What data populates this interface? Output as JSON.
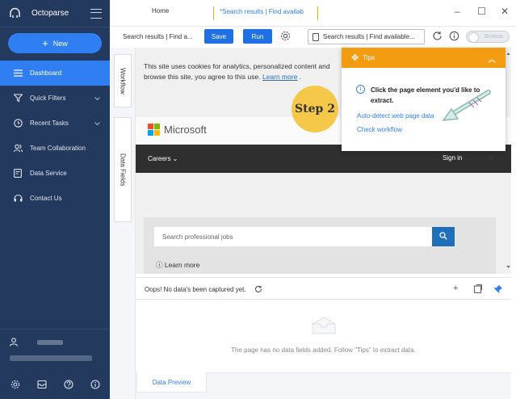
{
  "app": {
    "name": "Octoparse"
  },
  "sidebar": {
    "new_label": "New",
    "items": [
      {
        "label": "Dashboard",
        "icon": "dashboard-icon",
        "active": true
      },
      {
        "label": "Quick Filters",
        "icon": "filter-icon",
        "expandable": true
      },
      {
        "label": "Recent Tasks",
        "icon": "clock-icon",
        "expandable": true
      },
      {
        "label": "Team Collaboration",
        "icon": "team-icon"
      },
      {
        "label": "Data Service",
        "icon": "data-service-icon"
      },
      {
        "label": "Contact Us",
        "icon": "headset-icon"
      }
    ],
    "bottom_icons": [
      "settings-icon",
      "inbox-icon",
      "help-icon",
      "info-icon"
    ]
  },
  "tabs": {
    "home": "Home",
    "active": "*Search results | Find availab"
  },
  "toolbar": {
    "task_name": "Search results | Find a...",
    "save_label": "Save",
    "run_label": "Run",
    "url_text": "Search results | Find available...",
    "browse_label": "Browse"
  },
  "side_tabs": {
    "workflow": "Workflow",
    "data_fields": "Data Fields"
  },
  "page": {
    "cookie_text": "This site uses cookies for analytics, personalized content and",
    "cookie_text2": "browse this site, you agree to this use.",
    "learn_more": "Learn more",
    "logo_text": "Microsoft",
    "careers": "Careers",
    "sign_in": "Sign in",
    "search_placeholder": "Search professional jobs",
    "learn_more2": "Learn more"
  },
  "tips": {
    "title": "Tips",
    "instruction": "Click the page element you'd like to extract.",
    "link1": "Auto-detect web page data",
    "link2": "Check workflow"
  },
  "step_badge": "Step 2",
  "data_panel": {
    "message": "Oops! No data's been captured yet.",
    "empty_text": "The page has no data fields added. Follow \"Tips\" to extract data.",
    "tab_label": "Data Preview"
  },
  "colors": {
    "sidebar_bg": "#24395e",
    "accent": "#2f7ff2",
    "tips_header": "#f39c12",
    "step_badge": "#f5c84a"
  }
}
